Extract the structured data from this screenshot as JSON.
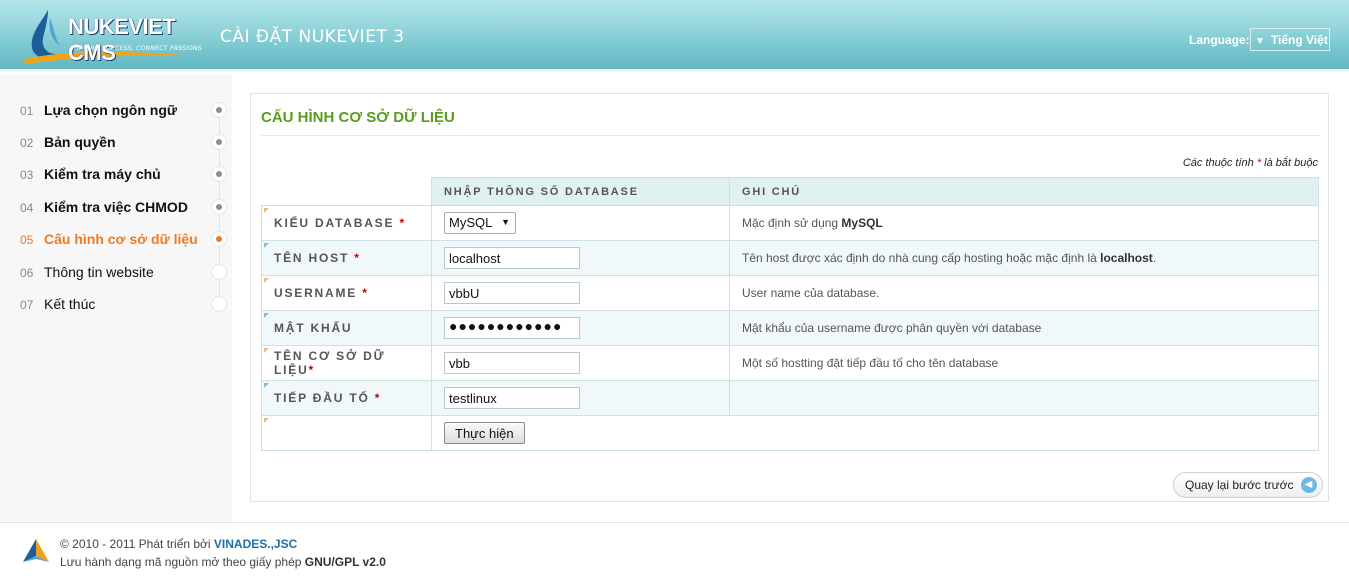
{
  "header": {
    "logo_text": "NUKEVIET CMS",
    "logo_tagline": "SHARING SUCCESS, CONNECT PASSIONS",
    "title": "CÀI ĐẶT NUKEVIET 3",
    "language_label": "Language:",
    "language_value": "Tiếng Việt"
  },
  "sidebar": {
    "steps": [
      {
        "num": "01",
        "label": "Lựa chọn ngôn ngữ",
        "state": "done"
      },
      {
        "num": "02",
        "label": "Bản quyền",
        "state": "done"
      },
      {
        "num": "03",
        "label": "Kiểm tra máy chủ",
        "state": "done"
      },
      {
        "num": "04",
        "label": "Kiểm tra việc CHMOD",
        "state": "done"
      },
      {
        "num": "05",
        "label": "Cấu hình cơ sở dữ liệu",
        "state": "active"
      },
      {
        "num": "06",
        "label": "Thông tin website",
        "state": "todo"
      },
      {
        "num": "07",
        "label": "Kết thúc",
        "state": "todo"
      }
    ]
  },
  "main": {
    "title": "CẤU HÌNH CƠ SỞ DỮ LIỆU",
    "required_note_prefix": "Các thuộc tính",
    "required_star": "*",
    "required_note_suffix": "là bắt buộc",
    "col_input": "NHẬP THÔNG SỐ DATABASE",
    "col_note": "GHI CHÚ",
    "rows": [
      {
        "label": "KIỂU DATABASE",
        "required": "*",
        "note_prefix": "Mặc định sử dụng ",
        "note_bold": "MySQL",
        "note_suffix": ""
      },
      {
        "label": "TÊN HOST",
        "required": "*",
        "value": "localhost",
        "note_prefix": "Tên host được xác định do nhà cung cấp hosting hoặc mặc định là ",
        "note_bold": "localhost",
        "note_suffix": "."
      },
      {
        "label": "USERNAME",
        "required": "*",
        "value": "vbbU",
        "note_prefix": "User name của database.",
        "note_bold": "",
        "note_suffix": ""
      },
      {
        "label": "MẬT KHẨU",
        "required": "",
        "value": "●●●●●●●●●●●●",
        "note_prefix": "Mật khẩu của username được phân quyền với database",
        "note_bold": "",
        "note_suffix": ""
      },
      {
        "label": "TÊN CƠ SỞ DỮ LIỆU",
        "required": "*",
        "value": "vbb",
        "note_prefix": "Một số hostting đặt tiếp đầu tố cho tên database",
        "note_bold": "",
        "note_suffix": ""
      },
      {
        "label": "TIẾP ĐẦU TỐ",
        "required": "*",
        "value": "testlinux",
        "note_prefix": "",
        "note_bold": "",
        "note_suffix": ""
      }
    ],
    "db_type_value": "MySQL",
    "submit_label": "Thực hiện",
    "back_label": "Quay lại bước trước"
  },
  "footer": {
    "line1_prefix": "© 2010 - 2011 Phát triển bởi ",
    "line1_link": "VINADES.,JSC",
    "line2_prefix": "Lưu hành dạng mã nguồn mở theo giấy phép ",
    "line2_bold": "GNU/GPL v2.0"
  },
  "colors": {
    "accent_green": "#5a9c1e",
    "active_orange": "#f07a22",
    "header_teal": "#5fb7c1",
    "link_blue": "#1e6fa8"
  }
}
